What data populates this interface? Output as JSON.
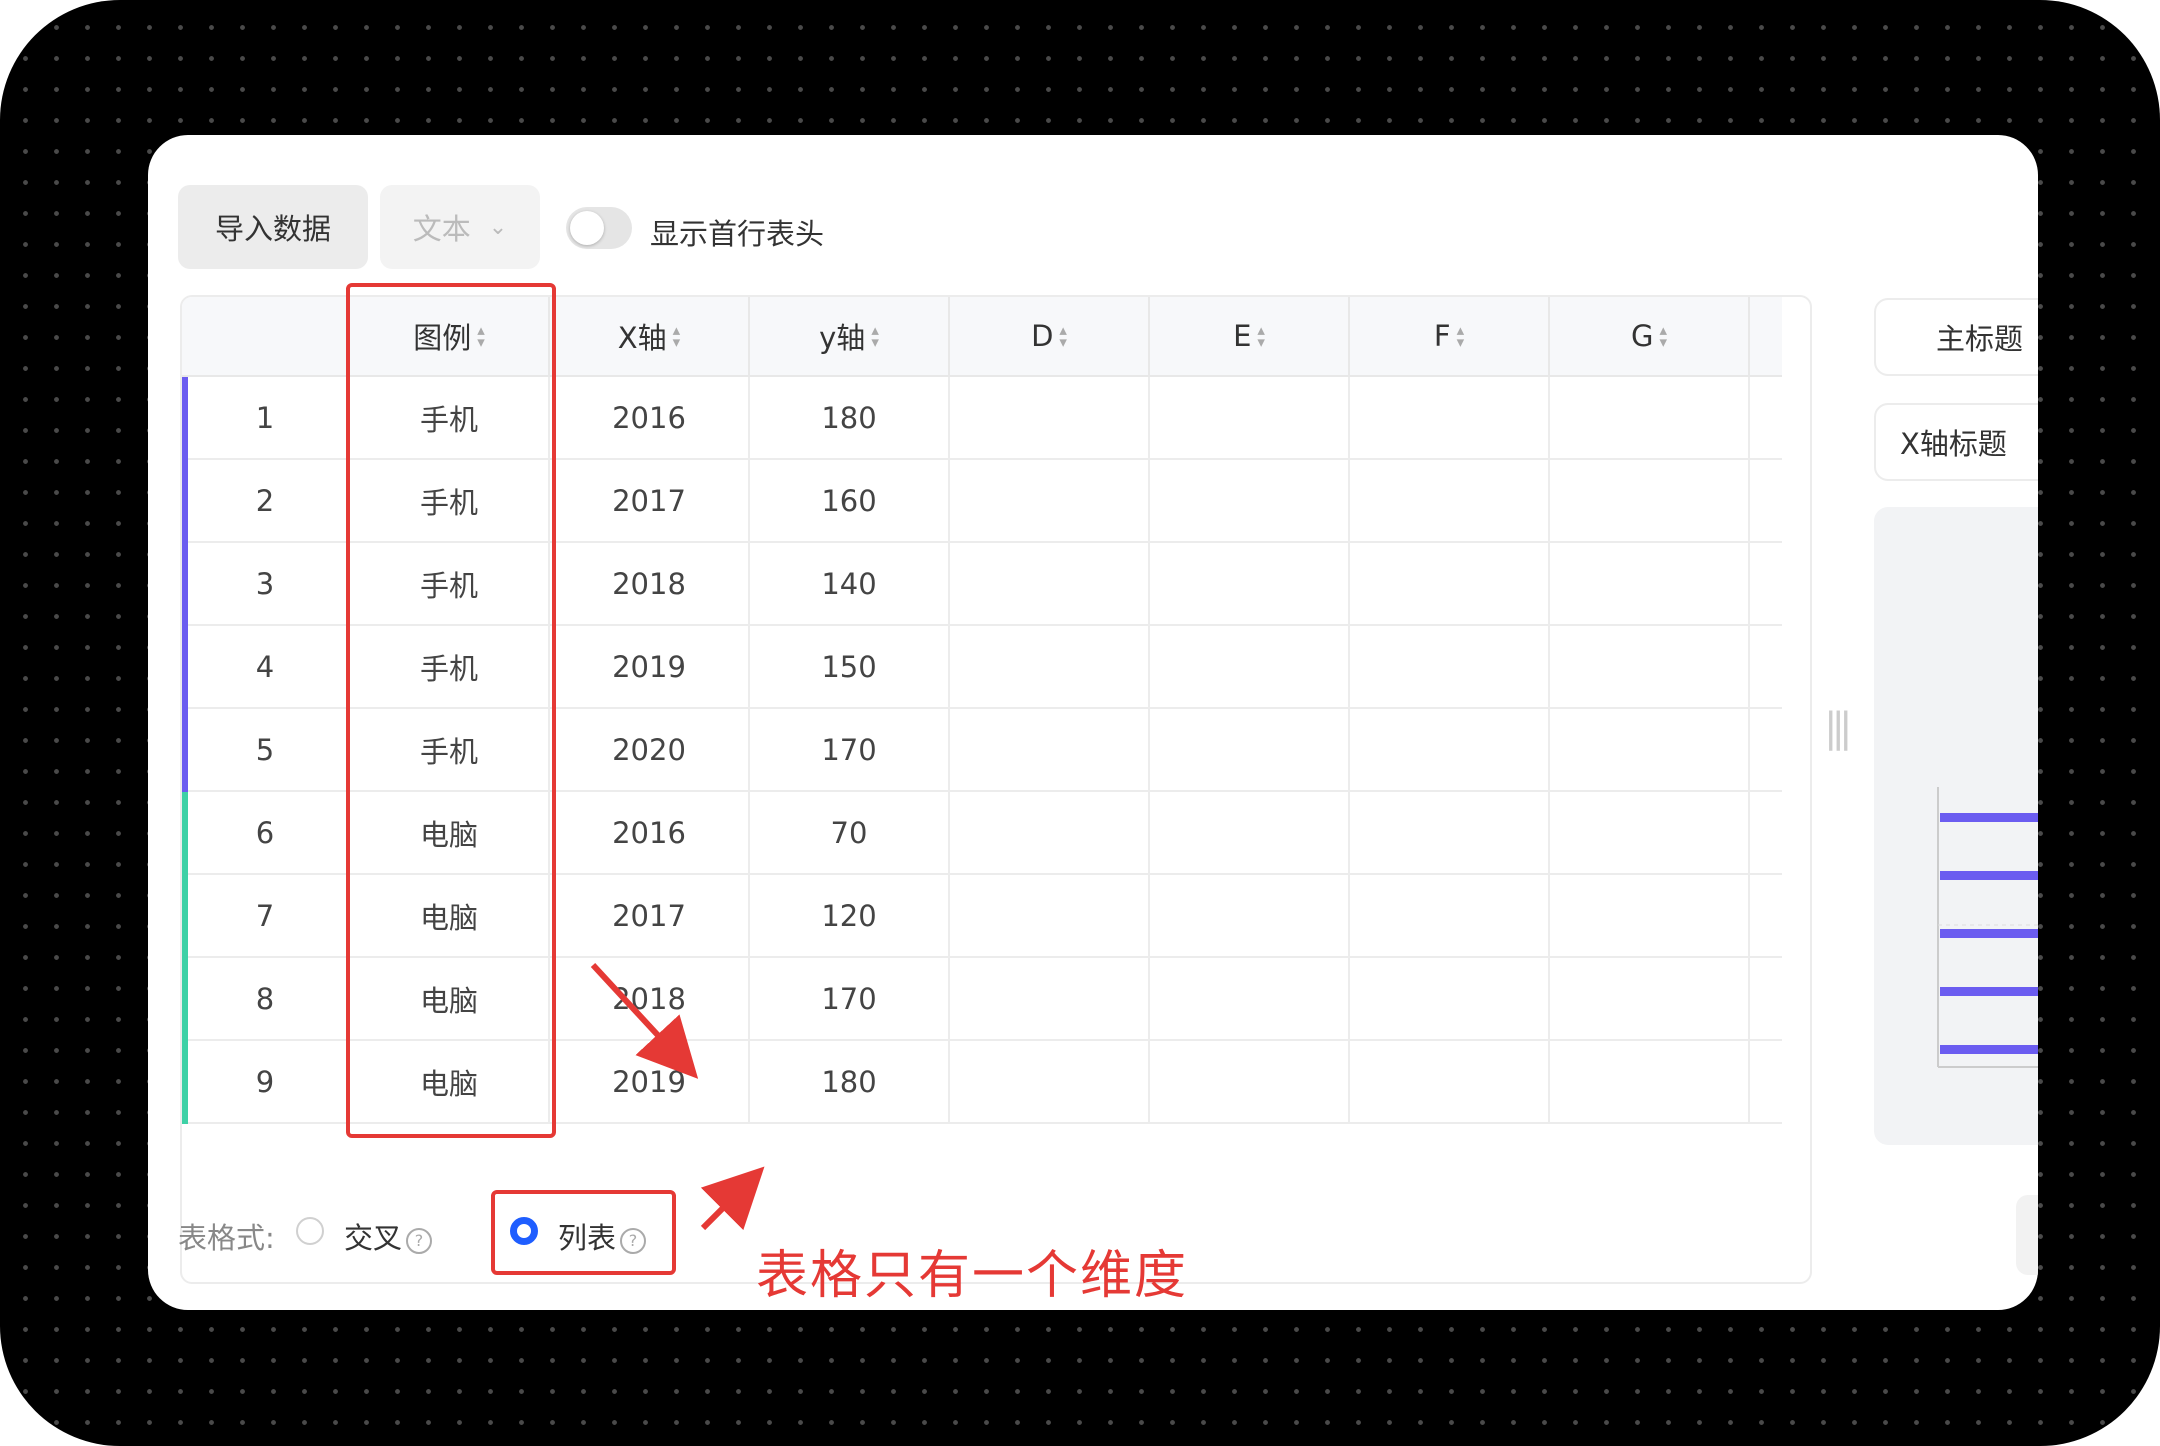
{
  "toolbar": {
    "import_label": "导入数据",
    "type_select": "文本",
    "show_header_label": "显示首行表头"
  },
  "table": {
    "columns": [
      "图例",
      "X轴",
      "y轴",
      "D",
      "E",
      "F",
      "G"
    ],
    "rows": [
      {
        "index": "1",
        "legend": "手机",
        "x": "2016",
        "y": "180",
        "group_color": "#6b5cf0"
      },
      {
        "index": "2",
        "legend": "手机",
        "x": "2017",
        "y": "160",
        "group_color": "#6b5cf0"
      },
      {
        "index": "3",
        "legend": "手机",
        "x": "2018",
        "y": "140",
        "group_color": "#6b5cf0"
      },
      {
        "index": "4",
        "legend": "手机",
        "x": "2019",
        "y": "150",
        "group_color": "#6b5cf0"
      },
      {
        "index": "5",
        "legend": "手机",
        "x": "2020",
        "y": "170",
        "group_color": "#6b5cf0"
      },
      {
        "index": "6",
        "legend": "电脑",
        "x": "2016",
        "y": "70",
        "group_color": "#3ed1a6"
      },
      {
        "index": "7",
        "legend": "电脑",
        "x": "2017",
        "y": "120",
        "group_color": "#3ed1a6"
      },
      {
        "index": "8",
        "legend": "电脑",
        "x": "2018",
        "y": "170",
        "group_color": "#3ed1a6"
      },
      {
        "index": "9",
        "legend": "电脑",
        "x": "2019",
        "y": "180",
        "group_color": "#3ed1a6"
      }
    ]
  },
  "right_panel": {
    "main_title_label": "主标题",
    "x_axis_title_label": "X轴标题",
    "drag_handle_glyph": "|||"
  },
  "footer": {
    "format_label": "表格式:",
    "option_cross": "交叉",
    "option_list": "列表",
    "help_glyph": "?",
    "selected": "列表"
  },
  "annotation": {
    "text": "表格只有一个维度",
    "color": "#e53935"
  },
  "colors": {
    "accent_blue": "#1f5eff",
    "series_purple": "#6b5cf0",
    "series_green": "#3ed1a6"
  }
}
